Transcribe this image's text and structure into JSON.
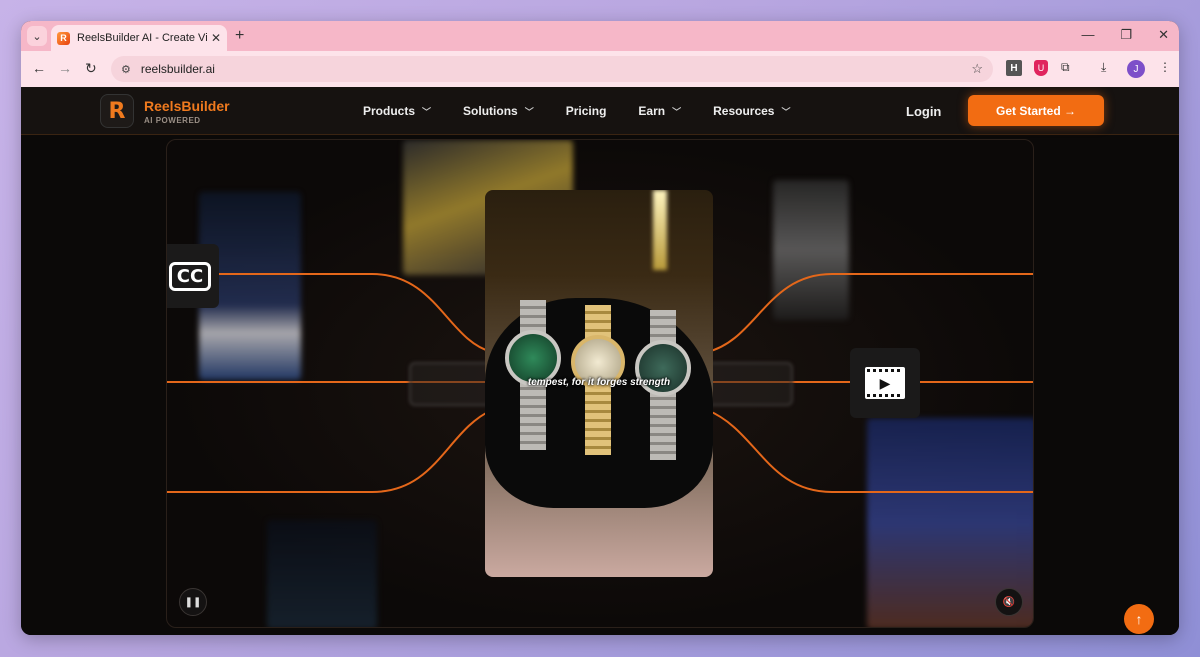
{
  "browser": {
    "tab_title": "ReelsBuilder AI - Create Viral Co",
    "tab_close": "✕",
    "new_tab": "+",
    "url": "reelsbuilder.ai",
    "ext_h": "H",
    "profile_initial": "J"
  },
  "nav": {
    "brand": "ReelsBuilder",
    "brand_sub": "AI POWERED",
    "logo_letter": "R",
    "menu": [
      "Products",
      "Solutions",
      "Pricing",
      "Earn",
      "Resources"
    ],
    "login": "Login",
    "cta": "Get Started →"
  },
  "hero": {
    "cc_label": "CC",
    "caption": "tempest, for it forges strength",
    "pause_icon": "pause-icon",
    "mute_icon": "mute-icon"
  },
  "colors": {
    "accent": "#f26c12",
    "tabstrip": "#f6b7c8",
    "toolbar": "#fde3ea"
  }
}
